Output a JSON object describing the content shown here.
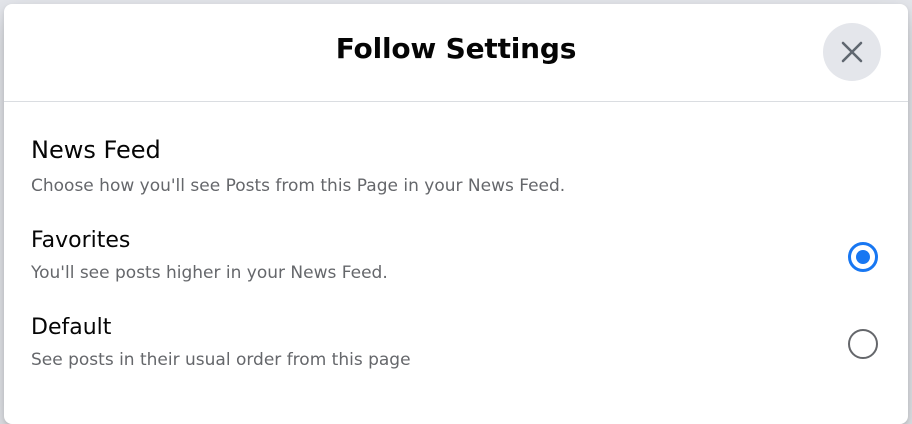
{
  "dialog": {
    "title": "Follow Settings",
    "close_icon": "close-icon"
  },
  "news_feed": {
    "heading": "News Feed",
    "description": "Choose how you'll see Posts from this Page in your News Feed."
  },
  "options": [
    {
      "label": "Favorites",
      "description": "You'll see posts higher in your News Feed.",
      "selected": true
    },
    {
      "label": "Default",
      "description": "See posts in their usual order from this page",
      "selected": false
    }
  ],
  "colors": {
    "accent": "#1877f2",
    "secondary_text": "#65676b",
    "close_button_bg": "#e4e6eb"
  }
}
